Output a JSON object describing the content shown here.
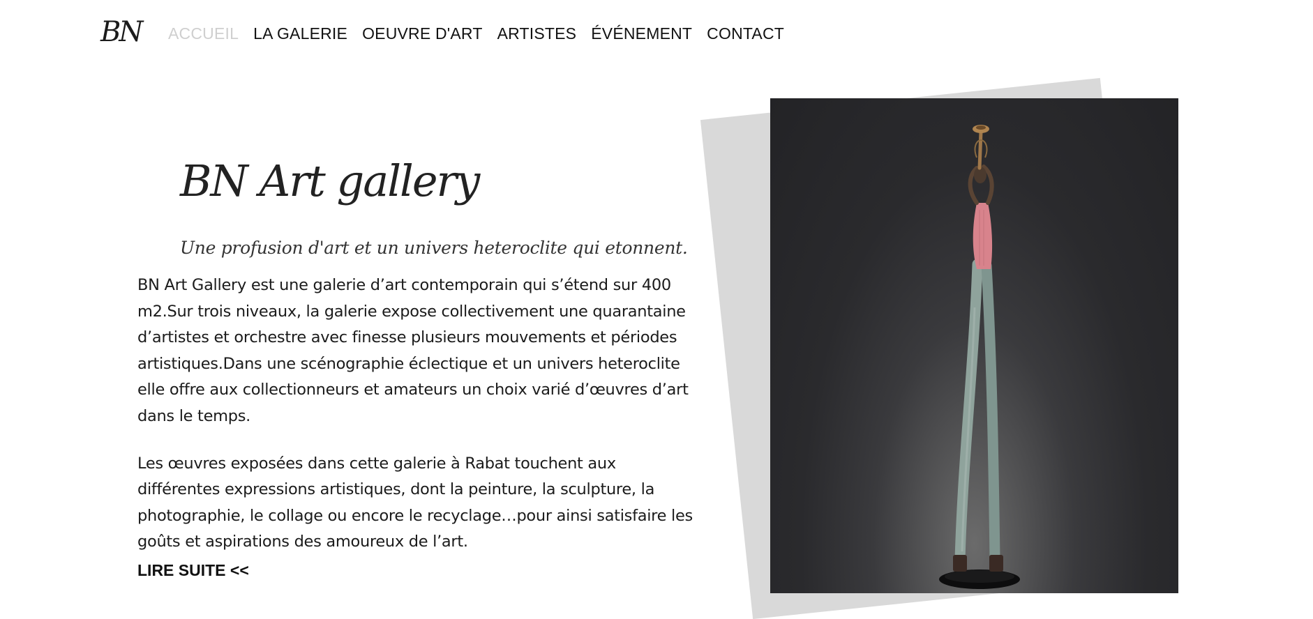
{
  "header": {
    "logo_text": "BN",
    "nav": [
      {
        "label": "ACCUEIL",
        "active": true
      },
      {
        "label": "LA GALERIE",
        "active": false
      },
      {
        "label": "OEUVRE D'ART",
        "active": false
      },
      {
        "label": "ARTISTES",
        "active": false
      },
      {
        "label": "ÉVÉNEMENT",
        "active": false
      },
      {
        "label": "CONTACT",
        "active": false
      }
    ]
  },
  "hero": {
    "title": "BN Art gallery",
    "subtitle": "Une profusion d'art et un univers heteroclite qui etonnent.",
    "paragraphs": [
      "BN Art Gallery est une galerie d’art contemporain qui s’étend sur 400 m2.Sur trois niveaux, la galerie expose collectivement une quarantaine d’artistes et orchestre avec finesse plusieurs mouvements et périodes artistiques.Dans une scénographie éclectique et un univers heteroclite elle offre aux collectionneurs et amateurs un choix varié d’œuvres d’art dans le temps.",
      "Les œuvres exposées dans cette galerie à Rabat touchent aux différentes expressions artistiques, dont la peinture, la sculpture, la photographie, le collage ou encore le recyclage…pour ainsi satisfaire les goûts et aspirations des amoureux de l’art."
    ],
    "read_more": "LIRE SUITE <<"
  },
  "image": {
    "subject": "sculpture-trumpet-player",
    "colors": {
      "background": "#2a2a2d",
      "frame_shadow": "#d9d9d9",
      "torso": "#d8838c",
      "legs": "#8fa39c"
    }
  },
  "colors": {
    "nav_active": "#cfcfcf",
    "text": "#1b1b1b",
    "background": "#ffffff"
  }
}
